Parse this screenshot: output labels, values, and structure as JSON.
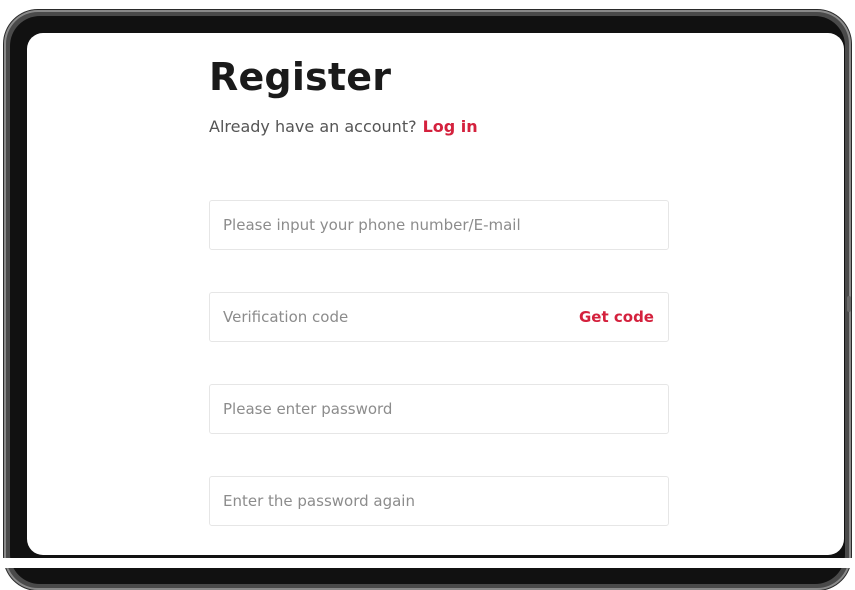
{
  "register": {
    "title": "Register",
    "account_prompt": "Already have an account?",
    "login_link": "Log in",
    "phone_email_placeholder": "Please input your phone number/E-mail",
    "verification_placeholder": "Verification code",
    "get_code_label": "Get code",
    "password_placeholder": "Please enter password",
    "confirm_password_placeholder": "Enter the password again"
  },
  "colors": {
    "accent": "#d4213d",
    "title": "#1a1a1a",
    "placeholder": "#8c8c8c",
    "field_border": "#e6e6e6",
    "device_frame": "#4a4a4a"
  }
}
